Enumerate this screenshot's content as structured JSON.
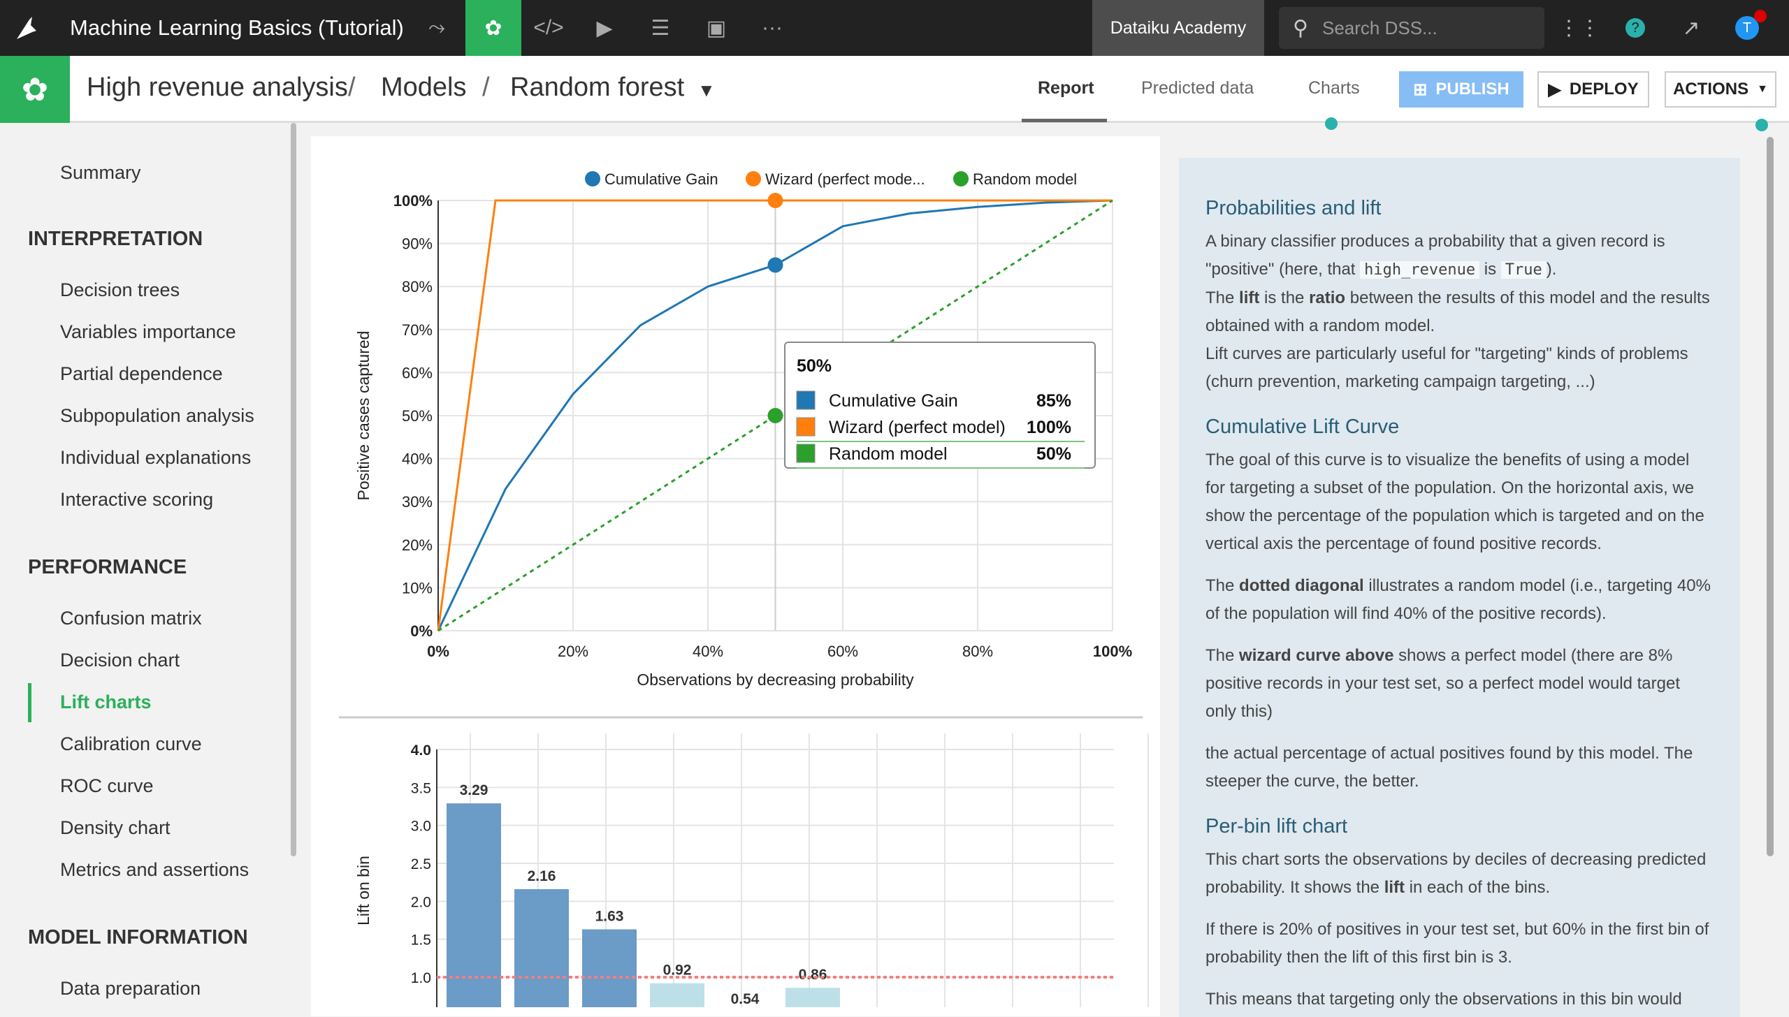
{
  "topbar": {
    "project": "Machine Learning Basics (Tutorial)",
    "workspace": "Dataiku Academy",
    "search_placeholder": "Search DSS...",
    "avatar": "T"
  },
  "subbar": {
    "crumbs": [
      "High revenue analysis",
      "/",
      "Models",
      "/",
      "Random forest"
    ],
    "tabs": [
      "Report",
      "Predicted data",
      "Charts"
    ],
    "active_tab": "Report",
    "publish": "PUBLISH",
    "deploy": "DEPLOY",
    "actions": "ACTIONS"
  },
  "sidebar": {
    "summary": "Summary",
    "sections": [
      {
        "title": "INTERPRETATION",
        "items": [
          "Decision trees",
          "Variables importance",
          "Partial dependence",
          "Subpopulation analysis",
          "Individual explanations",
          "Interactive scoring"
        ]
      },
      {
        "title": "PERFORMANCE",
        "items": [
          "Confusion matrix",
          "Decision chart",
          "Lift charts",
          "Calibration curve",
          "ROC curve",
          "Density chart",
          "Metrics and assertions"
        ]
      },
      {
        "title": "MODEL INFORMATION",
        "items": [
          "Data preparation"
        ]
      }
    ],
    "active": "Lift charts",
    "accent": "#2ab1ac"
  },
  "chart_data": [
    {
      "type": "line",
      "xlabel": "Observations by decreasing probability",
      "ylabel": "Positive cases captured",
      "xlim": [
        0,
        100
      ],
      "ylim": [
        0,
        100
      ],
      "grid": true,
      "legend": "top",
      "xticks": [
        "0%",
        "20%",
        "40%",
        "60%",
        "80%",
        "100%"
      ],
      "yticks": [
        "0%",
        "10%",
        "20%",
        "30%",
        "40%",
        "50%",
        "60%",
        "70%",
        "80%",
        "90%",
        "100%"
      ],
      "series": [
        {
          "name": "Cumulative Gain",
          "color": "#1f77b4",
          "x": [
            0,
            10,
            20,
            30,
            40,
            50,
            60,
            70,
            80,
            90,
            100
          ],
          "y": [
            0,
            33,
            55,
            71,
            80,
            85,
            94,
            97,
            98.5,
            99.5,
            100
          ]
        },
        {
          "name": "Wizard (perfect mode...",
          "color": "#ff7f0e",
          "x": [
            0,
            8.5,
            100
          ],
          "y": [
            0,
            100,
            100
          ]
        },
        {
          "name": "Random model",
          "color": "#2ca02c",
          "dashed": true,
          "x": [
            0,
            100
          ],
          "y": [
            0,
            100
          ]
        }
      ],
      "tooltip": {
        "x_label": "50%",
        "rows": [
          {
            "name": "Cumulative Gain",
            "value": "85%",
            "color": "#1f77b4"
          },
          {
            "name": "Wizard (perfect model)",
            "value": "100%",
            "color": "#ff7f0e"
          },
          {
            "name": "Random model",
            "value": "50%",
            "color": "#2ca02c"
          }
        ]
      }
    },
    {
      "type": "bar",
      "ylabel": "Lift on bin",
      "ylim": [
        0,
        4
      ],
      "yticks": [
        "1.0",
        "1.5",
        "2.0",
        "2.5",
        "3.0",
        "3.5",
        "4.0"
      ],
      "grid": true,
      "reference_line": 1.0,
      "values": [
        3.29,
        2.16,
        1.63,
        0.92,
        0.54,
        0.86
      ],
      "labels": [
        "3.29",
        "2.16",
        "1.63",
        "0.92",
        "0.54",
        "0.86"
      ],
      "colors": {
        "above": "#6b9bc7",
        "below": "#bde0e8",
        "reference": "#f08080"
      }
    }
  ],
  "panel": {
    "h1": "Probabilities and lift",
    "p1a": "A binary classifier produces a probability that a given record is \"positive\" (here, that ",
    "p1code1": "high_revenue",
    "p1b": " is ",
    "p1code2": "True",
    "p1c": ").",
    "p2a": "The ",
    "p2b1": "lift",
    "p2c": " is the ",
    "p2b2": "ratio",
    "p2d": " between the results of this model and the results obtained with a random model.",
    "p3": "Lift curves are particularly useful for \"targeting\" kinds of problems (churn prevention, marketing campaign targeting, ...)",
    "h2": "Cumulative Lift Curve",
    "p4": "The goal of this curve is to visualize the benefits of using a model for targeting a subset of the population. On the horizontal axis, we show the percentage of the population which is targeted and on the vertical axis the percentage of found positive records.",
    "p5a": "The ",
    "p5b": "dotted diagonal",
    "p5c": " illustrates a random model (i.e., targeting 40% of the population will find 40% of the positive records).",
    "p6a": "The ",
    "p6b": "wizard curve above",
    "p6c": " shows a perfect model (there are 8% positive records in your test set, so a perfect model would target only this)",
    "p7": "the actual percentage of actual positives found by this model. The steeper the curve, the better.",
    "h3": "Per-bin lift chart",
    "p8a": "This chart sorts the observations by deciles of decreasing predicted probability. It shows the ",
    "p8b": "lift",
    "p8c": " in each of the bins.",
    "p9": "If there is 20% of positives in your test set, but 60% in the first bin of probability then the lift of this first bin is 3.",
    "p10": "This means that targeting only the observations in this bin would"
  }
}
